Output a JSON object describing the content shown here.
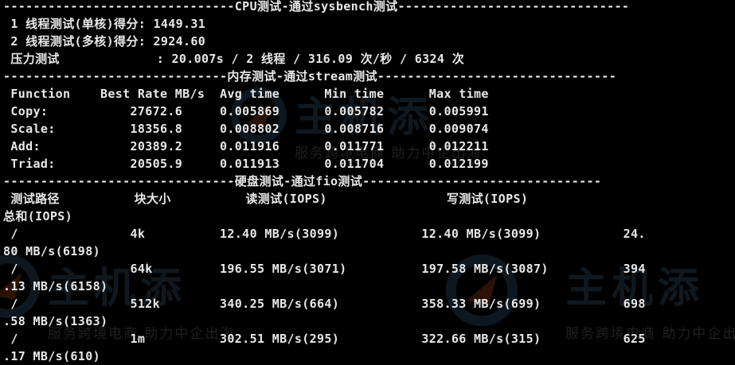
{
  "watermark": {
    "logo_text": "主机添",
    "slogan": "服务跨境电商 助力中企出海",
    "logo_partial": "主机添",
    "slogan_partial": "服务跨境电商 助力中企出海"
  },
  "terminal": {
    "lines": [
      "-------------------------------CPU测试-通过sysbench测试-------------------------------",
      " 1 线程测试(单核)得分: 1449.31",
      " 2 线程测试(多核)得分: 2924.60",
      " 压力测试             : 20.007s / 2 线程 / 316.09 次/秒 / 6324 次",
      "------------------------------内存测试-通过stream测试--------------------------------",
      " Function    Best Rate MB/s  Avg time      Min time      Max time",
      " Copy:           27672.6     0.005869      0.005782      0.005991",
      " Scale:          18356.8     0.008802      0.008716      0.009074",
      " Add:            20389.2     0.011916      0.011771      0.012211",
      " Triad:          20505.9     0.011913      0.011704      0.012199",
      "-------------------------------硬盘测试-通过fio测试--------------------------------",
      " 测试路径          块大小          读测试(IOPS)                写测试(IOPS)",
      "总和(IOPS)",
      " /               4k          12.40 MB/s(3099)           12.40 MB/s(3099)           24.",
      "80 MB/s(6198)",
      " /               64k         196.55 MB/s(3071)          197.58 MB/s(3087)          394",
      ".13 MB/s(6158)",
      " /               512k        340.25 MB/s(664)           358.33 MB/s(699)           698",
      ".58 MB/s(1363)",
      " /               1m          302.51 MB/s(295)           322.66 MB/s(315)           625",
      ".17 MB/s(610)"
    ]
  }
}
